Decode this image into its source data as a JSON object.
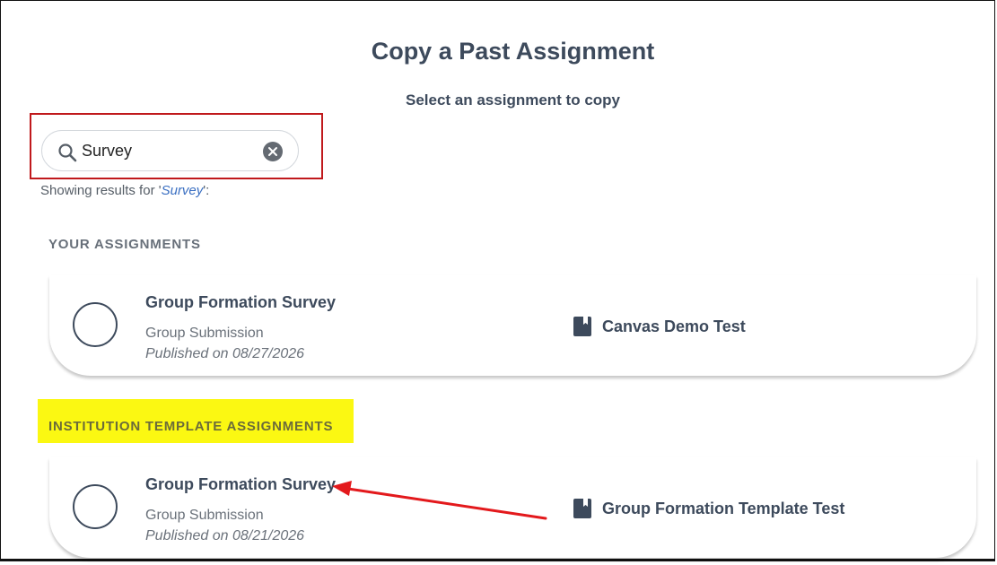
{
  "page": {
    "title": "Copy a Past Assignment",
    "subtitle": "Select an assignment to copy"
  },
  "search": {
    "value": "Survey",
    "icon": "search-icon",
    "clear_icon": "close-icon"
  },
  "results": {
    "prefix": "Showing results for '",
    "query": "Survey",
    "suffix": "':"
  },
  "sections": {
    "your": {
      "label": "YOUR ASSIGNMENTS",
      "assignment": {
        "title": "Group Formation Survey",
        "type": "Group Submission",
        "published": "Published on 08/27/2026",
        "course": "Canvas Demo Test",
        "icon": "book-icon"
      }
    },
    "institution": {
      "label": "INSTITUTION TEMPLATE ASSIGNMENTS",
      "assignment": {
        "title": "Group Formation Survey",
        "type": "Group Submission",
        "published": "Published on 08/21/2026",
        "course": "Group Formation Template Test",
        "icon": "book-icon"
      }
    }
  },
  "annotations": {
    "search_box_outline_color": "#c0191c",
    "section_highlight_color": "#fbf812",
    "arrow_color": "#e3191c"
  }
}
